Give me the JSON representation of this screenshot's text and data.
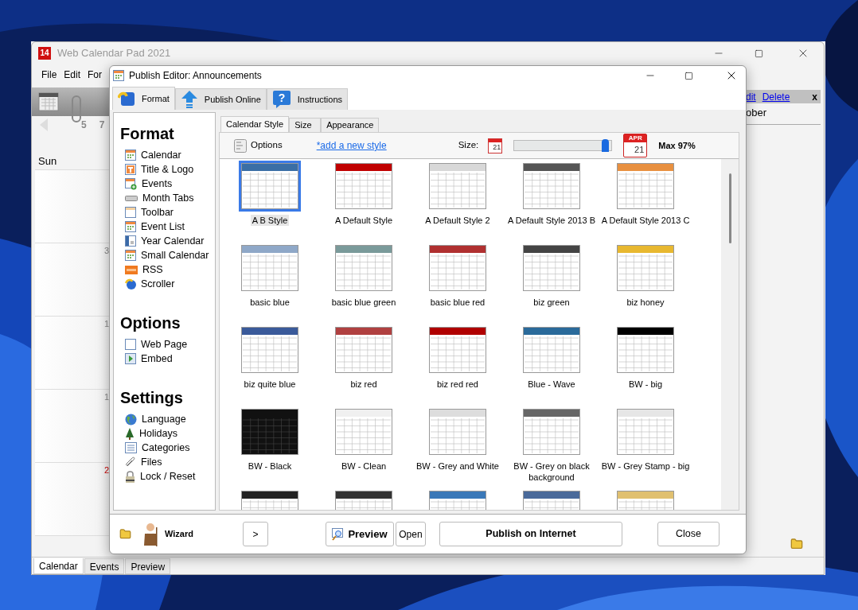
{
  "main_window": {
    "icon_label": "14",
    "title": "Web Calendar Pad 2021",
    "menu": [
      "File",
      "Edit",
      "For"
    ],
    "nav_days": [
      "5",
      "7"
    ],
    "day_header": "Sun",
    "day_numbers": [
      {
        "text": "3",
        "holiday": false
      },
      {
        "text": "1",
        "holiday": false
      },
      {
        "text": "1",
        "holiday": false
      },
      {
        "text": "2",
        "holiday": true
      }
    ],
    "panel_links": [
      "dit",
      "Delete"
    ],
    "panel_close": "x",
    "panel_text": "ober",
    "bottom_tabs": [
      {
        "label": "Calendar",
        "selected": true
      },
      {
        "label": "Events",
        "selected": false
      },
      {
        "label": "Preview",
        "selected": false
      }
    ]
  },
  "dialog": {
    "title": "Publish Editor: Announcements",
    "tabs": [
      {
        "label": "Format",
        "selected": true,
        "kind": "format"
      },
      {
        "label": "Publish Online",
        "selected": false,
        "kind": "publish"
      },
      {
        "label": "Instructions",
        "selected": false,
        "kind": "help",
        "icon_text": "?"
      }
    ],
    "sections": [
      {
        "title": "Format",
        "items": [
          "Calendar",
          "Title & Logo",
          "Events",
          "Month Tabs",
          "Toolbar",
          "Event List",
          "Year Calendar",
          "Small Calendar",
          "RSS",
          "Scroller"
        ]
      },
      {
        "title": "Options",
        "items": [
          "Web Page",
          "Embed"
        ]
      },
      {
        "title": "Settings",
        "items": [
          "Language",
          "Holidays",
          "Categories",
          "Files",
          "Lock / Reset"
        ]
      }
    ],
    "subtabs": [
      {
        "label": "Calendar Style",
        "selected": true
      },
      {
        "label": "Size",
        "selected": false
      },
      {
        "label": "Appearance",
        "selected": false
      }
    ],
    "options_label": "Options",
    "add_link": "*add a new style",
    "size_label": "Size:",
    "small_icon_day": "21",
    "large_icon": {
      "month": "APR",
      "day": "21"
    },
    "slider": {
      "level": 0.97
    },
    "max_label": "Max 97%",
    "styles": [
      {
        "name": "A B Style",
        "color": "#3a6ea5",
        "selected": true
      },
      {
        "name": "A Default Style",
        "color": "#c00000",
        "selected": false
      },
      {
        "name": "A Default Style 2",
        "color": "#d8d8d8",
        "selected": false
      },
      {
        "name": "A Default Style 2013 B",
        "color": "#555555",
        "selected": false
      },
      {
        "name": "A Default Style 2013 C",
        "color": "#e89040",
        "selected": false
      },
      {
        "name": "basic blue",
        "color": "#8fa8c8",
        "selected": false
      },
      {
        "name": "basic blue green",
        "color": "#7a9a9a",
        "selected": false
      },
      {
        "name": "basic blue red",
        "color": "#b03030",
        "selected": false
      },
      {
        "name": "biz green",
        "color": "#444444",
        "selected": false
      },
      {
        "name": "biz honey",
        "color": "#e8b830",
        "selected": false
      },
      {
        "name": "biz quite blue",
        "color": "#3a5a9a",
        "selected": false
      },
      {
        "name": "biz red",
        "color": "#b04040",
        "selected": false
      },
      {
        "name": "biz red red",
        "color": "#b00000",
        "selected": false
      },
      {
        "name": "Blue - Wave",
        "color": "#2a6a9a",
        "selected": false
      },
      {
        "name": "BW - big",
        "color": "#000000",
        "selected": false
      },
      {
        "name": "BW - Black",
        "color": "#111111",
        "selected": false
      },
      {
        "name": "BW - Clean",
        "color": "#f0f0f0",
        "selected": false
      },
      {
        "name": "BW - Grey and White",
        "color": "#dddddd",
        "selected": false
      },
      {
        "name": "BW - Grey on black background",
        "color": "#666666",
        "selected": false
      },
      {
        "name": "BW - Grey Stamp - big",
        "color": "#e6e6e6",
        "selected": false
      },
      {
        "color": "#222222",
        "selected": false
      },
      {
        "color": "#333333",
        "selected": false
      },
      {
        "color": "#3a78b8",
        "selected": false
      },
      {
        "color": "#4a6a9a",
        "selected": false
      },
      {
        "color": "#e0c070",
        "selected": false
      }
    ],
    "wizard_label": "Wizard",
    "next_button": ">",
    "preview_button": "Preview",
    "open_button": "Open",
    "publish_button": "Publish on Internet",
    "close_button": "Close"
  }
}
